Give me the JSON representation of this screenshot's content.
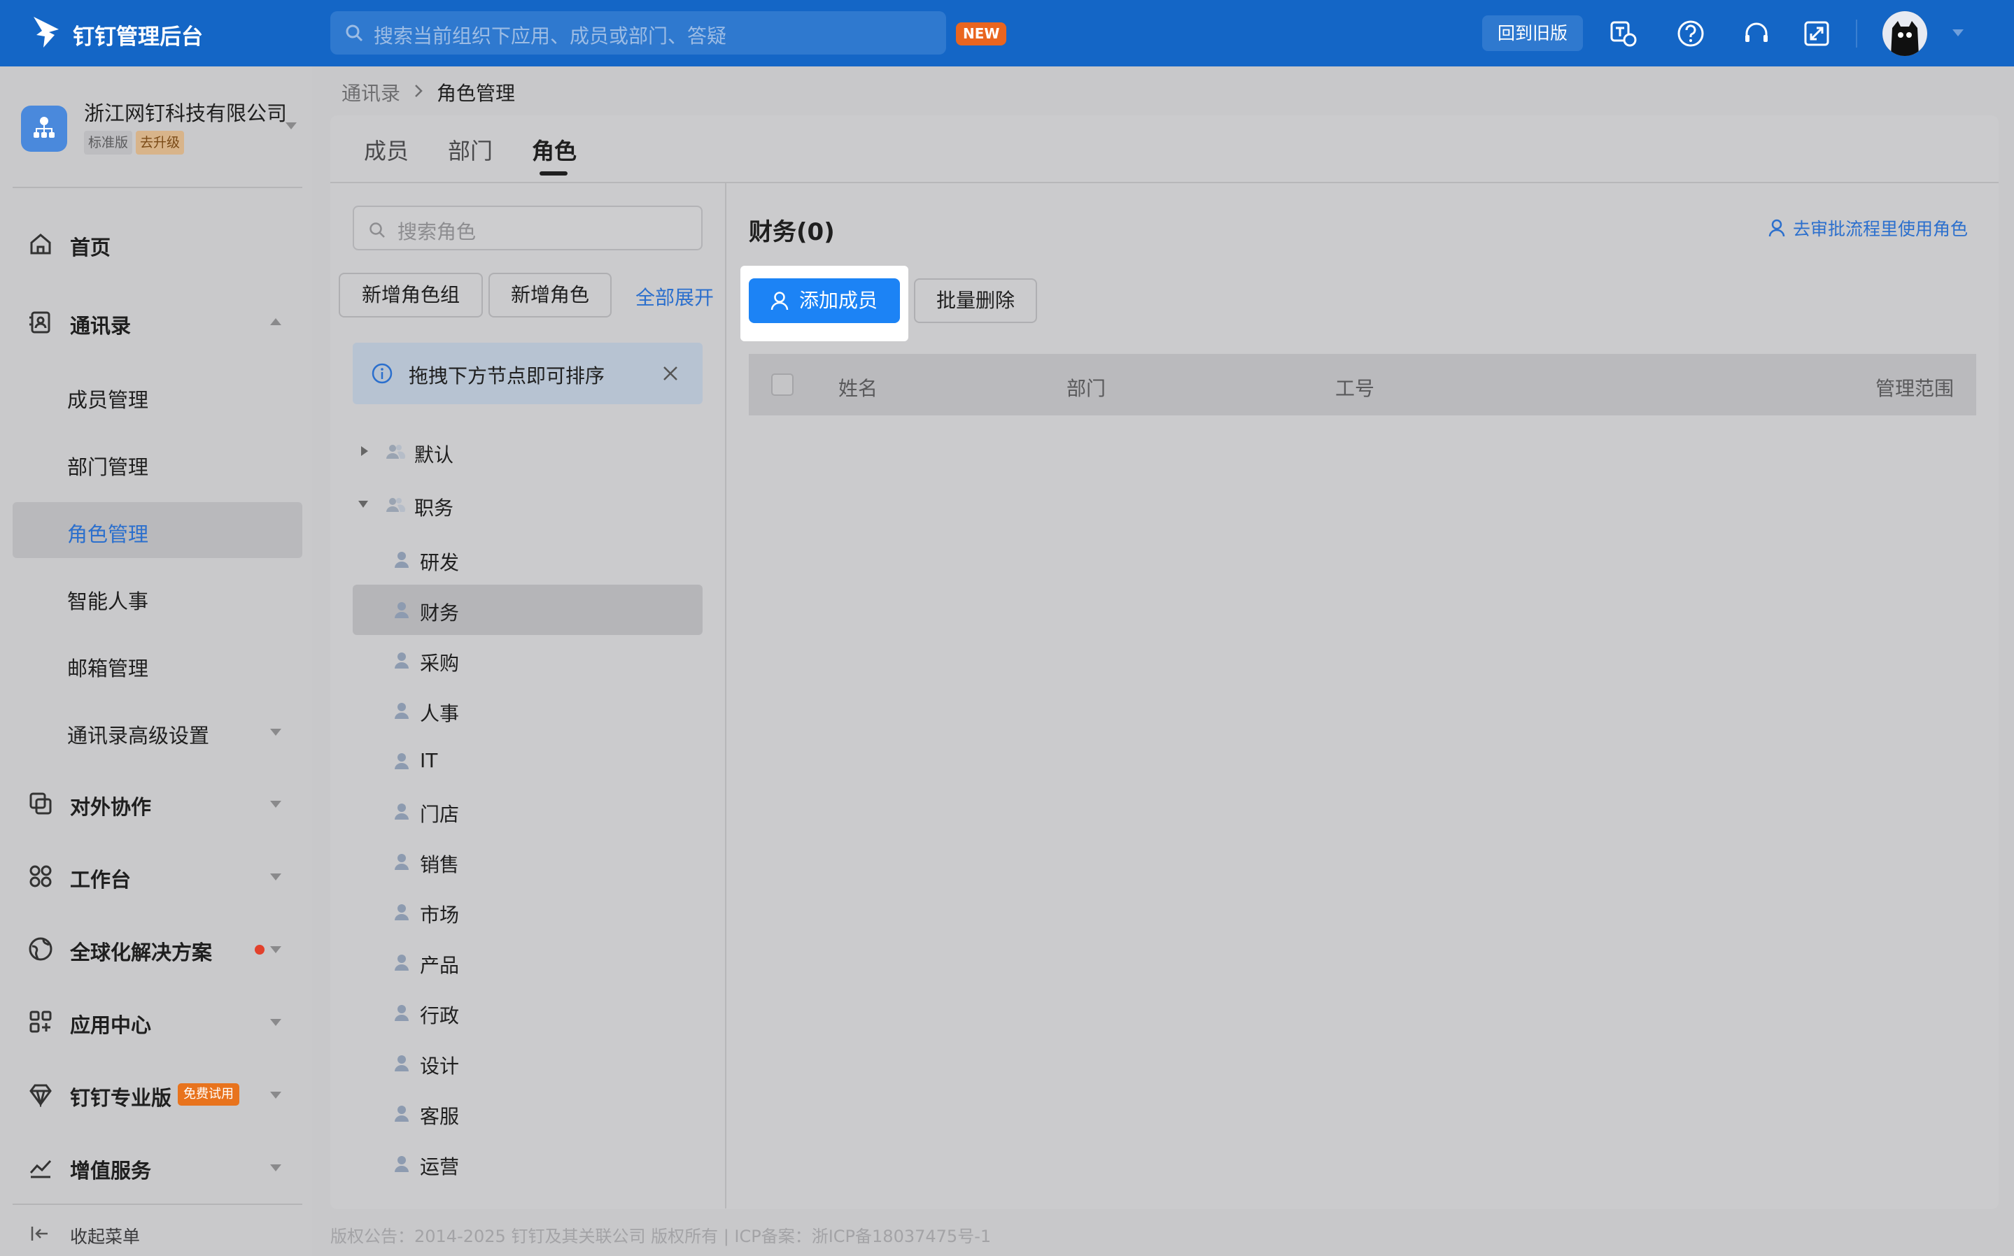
{
  "header": {
    "app_title": "钉钉管理后台",
    "search_placeholder": "搜索当前组织下应用、成员或部门、答疑",
    "new_badge": "NEW",
    "old_version_button": "回到旧版",
    "icons": [
      "translate-icon",
      "help-icon",
      "headset-icon",
      "fullscreen-icon",
      "avatar",
      "chevron-down-icon"
    ]
  },
  "sidebar": {
    "org_name": "浙江网钉科技有限公司",
    "edition_tag": "标准版",
    "upgrade_tag": "去升级",
    "items": [
      {
        "label": "首页",
        "icon": "home-icon"
      },
      {
        "label": "通讯录",
        "icon": "contacts-icon",
        "expanded": true,
        "children": [
          "成员管理",
          "部门管理",
          "角色管理",
          "智能人事",
          "邮箱管理",
          "通讯录高级设置"
        ]
      },
      {
        "label": "对外协作",
        "icon": "collab-icon"
      },
      {
        "label": "工作台",
        "icon": "workbench-icon"
      },
      {
        "label": "全球化解决方案",
        "icon": "globe-icon",
        "has_dot": true
      },
      {
        "label": "应用中心",
        "icon": "apps-icon"
      },
      {
        "label": "钉钉专业版",
        "icon": "diamond-icon",
        "badge": "免费试用"
      },
      {
        "label": "增值服务",
        "icon": "trend-icon"
      }
    ],
    "active_child": "角色管理",
    "collapse_label": "收起菜单",
    "colors": {
      "active_text": "#2b6fcd",
      "dot": "#e2412c",
      "trial": "#e8731d"
    }
  },
  "breadcrumb": {
    "parent": "通讯录",
    "current": "角色管理"
  },
  "tabs": [
    "成员",
    "部门",
    "角色"
  ],
  "active_tab": "角色",
  "left_panel": {
    "search_placeholder": "搜索角色",
    "add_group_button": "新增角色组",
    "add_role_button": "新增角色",
    "expand_all_link": "全部展开",
    "tip_text": "拖拽下方节点即可排序",
    "groups": [
      {
        "label": "默认",
        "expanded": false
      },
      {
        "label": "职务",
        "expanded": true,
        "roles": [
          "研发",
          "财务",
          "采购",
          "人事",
          "IT",
          "门店",
          "销售",
          "市场",
          "产品",
          "行政",
          "设计",
          "客服",
          "运营"
        ]
      }
    ],
    "selected_role": "财务"
  },
  "right_panel": {
    "title": "财务(0)",
    "approval_link": "去审批流程里使用角色",
    "add_member_button": "添加成员",
    "batch_delete_button": "批量删除",
    "columns": [
      "姓名",
      "部门",
      "工号",
      "管理范围"
    ],
    "rows": []
  },
  "footer": {
    "text": "版权公告：2014-2025 钉钉及其关联公司 版权所有 | ICP备案：浙ICP备18037475号-1"
  },
  "colors": {
    "topbar": "#1466c6",
    "primary": "#1c83f5",
    "link": "#2b6fcd",
    "badge": "#e9651f"
  }
}
